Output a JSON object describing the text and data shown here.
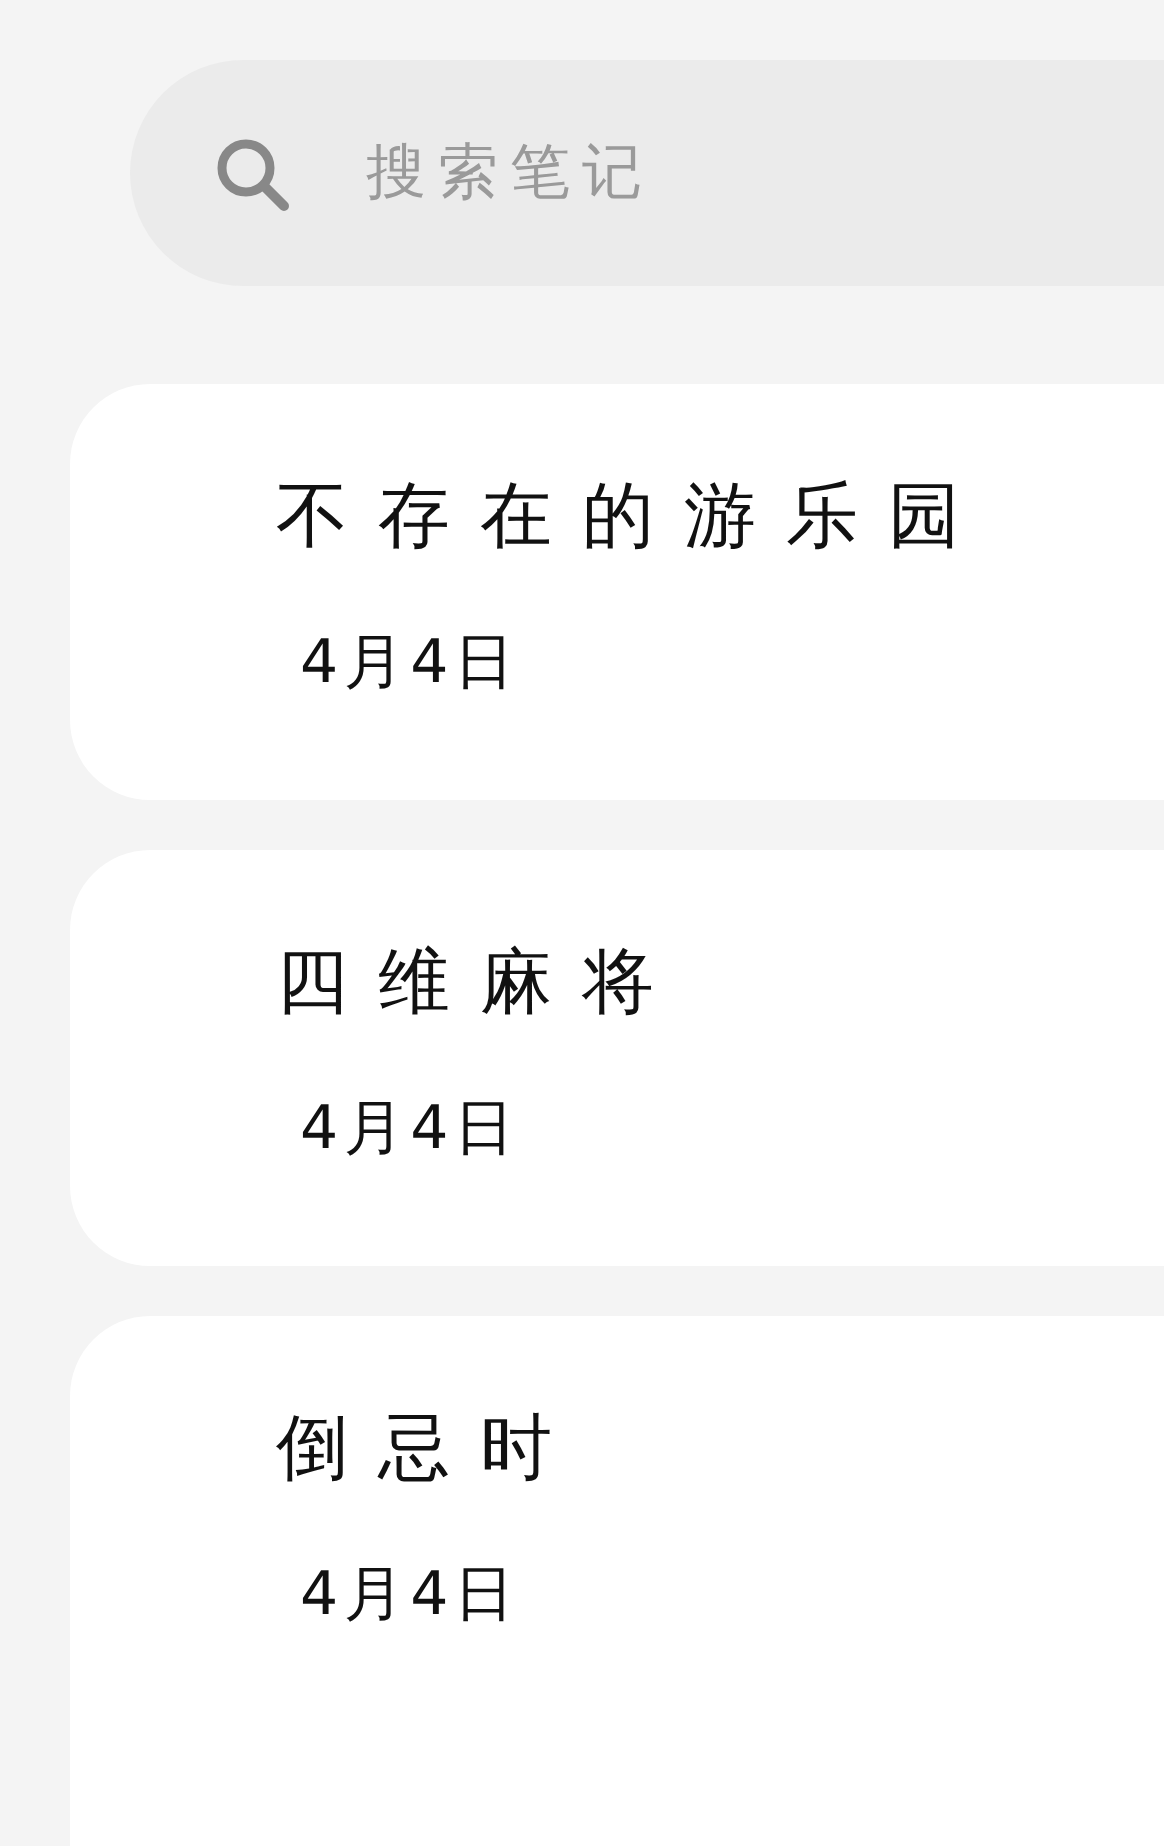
{
  "search": {
    "placeholder": "搜索笔记"
  },
  "notes": [
    {
      "title": "不存在的游乐园",
      "date": "4月4日"
    },
    {
      "title": "四维麻将",
      "date": "4月4日"
    },
    {
      "title": "倒忌时",
      "date": "4月4日"
    }
  ]
}
